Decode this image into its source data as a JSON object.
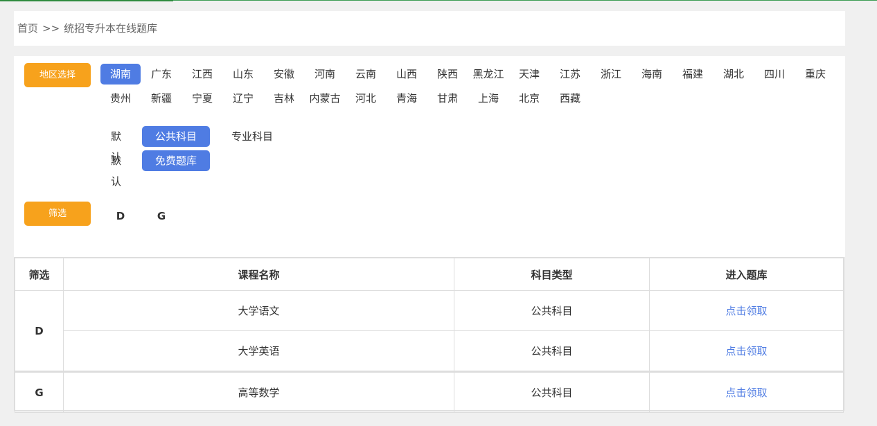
{
  "breadcrumb": {
    "home": "首页",
    "separator": ">>",
    "current": "统招专升本在线题库"
  },
  "region": {
    "button_label": "地区选择",
    "rows": [
      [
        "湖南",
        "广东",
        "江西",
        "山东",
        "安徽",
        "河南",
        "云南",
        "山西",
        "陕西",
        "黑龙江",
        "天津",
        "江苏",
        "浙江",
        "海南",
        "福建",
        "湖北",
        "四川",
        "重庆"
      ],
      [
        "贵州",
        "新疆",
        "宁夏",
        "辽宁",
        "吉林",
        "内蒙古",
        "河北",
        "青海",
        "甘肃",
        "上海",
        "北京",
        "西藏"
      ]
    ],
    "selected": "湖南"
  },
  "subject_filter": {
    "label": "默认",
    "options": [
      "公共科目",
      "专业科目"
    ],
    "selected": "公共科目"
  },
  "bank_filter": {
    "label": "默认",
    "options": [
      "免费题库"
    ],
    "selected": "免费题库"
  },
  "screen": {
    "button_label": "筛选",
    "letters": [
      "D",
      "G"
    ]
  },
  "table": {
    "headers": [
      "筛选",
      "课程名称",
      "科目类型",
      "进入题库"
    ],
    "groups": [
      {
        "letter": "D",
        "rows": [
          {
            "course": "大学语文",
            "type": "公共科目",
            "action": "点击领取"
          },
          {
            "course": "大学英语",
            "type": "公共科目",
            "action": "点击领取"
          }
        ]
      },
      {
        "letter": "G",
        "rows": [
          {
            "course": "高等数学",
            "type": "公共科目",
            "action": "点击领取"
          }
        ]
      }
    ]
  }
}
